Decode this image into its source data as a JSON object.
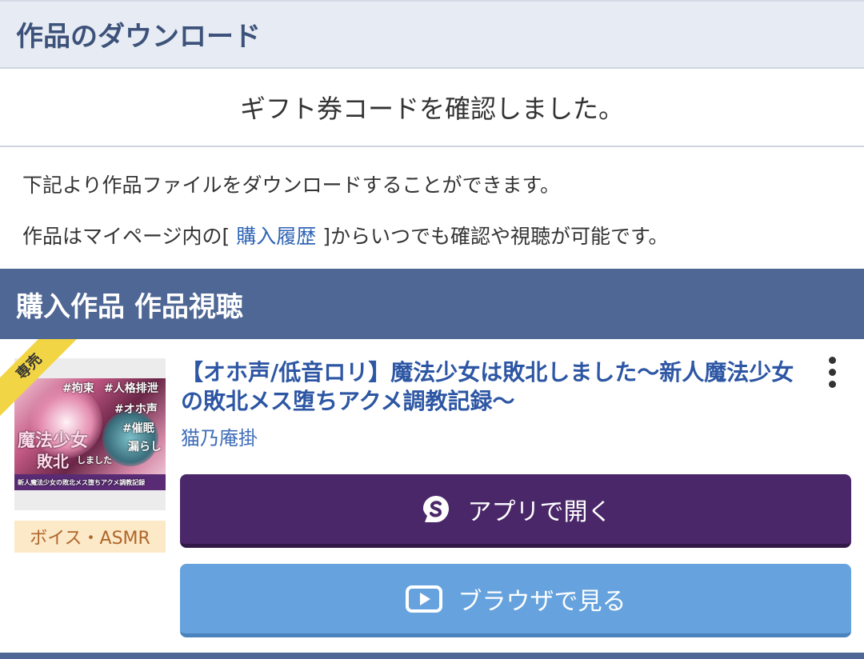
{
  "header": {
    "title": "作品のダウンロード"
  },
  "confirmation": {
    "message": "ギフト券コードを確認しました。"
  },
  "info": {
    "line1": "下記より作品ファイルをダウンロードすることができます。",
    "line2_prefix": "作品はマイページ内の[",
    "line2_link": "購入履歴",
    "line2_suffix": "]からいつでも確認や視聴が可能です。"
  },
  "section": {
    "title": "購入作品 作品視聴"
  },
  "work": {
    "ribbon": "専売",
    "title": "【オホ声/低音ロリ】魔法少女は敗北しました〜新人魔法少女の敗北メス堕ちアクメ調教記録〜",
    "author": "猫乃庵掛",
    "category": "ボイス・ASMR",
    "thumbnail_text": {
      "tag1": "#拘束",
      "tag2": "#人格排泄",
      "tag3": "#オホ声",
      "tag4": "#催眠",
      "tag5": "漏らし",
      "big1": "魔法少女",
      "big2": "敗北",
      "big3": "しました",
      "sub": "新人魔法少女の敗北メス堕ちアクメ調教記録"
    }
  },
  "buttons": {
    "app_label": "アプリで開く",
    "browser_label": "ブラウザで見る"
  },
  "colors": {
    "header_bg": "#e7ecf4",
    "section_bg": "#4f6795",
    "app_button": "#4a2768",
    "browser_button": "#66a3de",
    "title_link": "#2d56a4",
    "ribbon": "#f2d544",
    "category_bg": "#fbe9c8"
  },
  "icons": {
    "app": "app-logo-icon",
    "browser": "play-icon",
    "menu": "more-vertical-icon"
  }
}
